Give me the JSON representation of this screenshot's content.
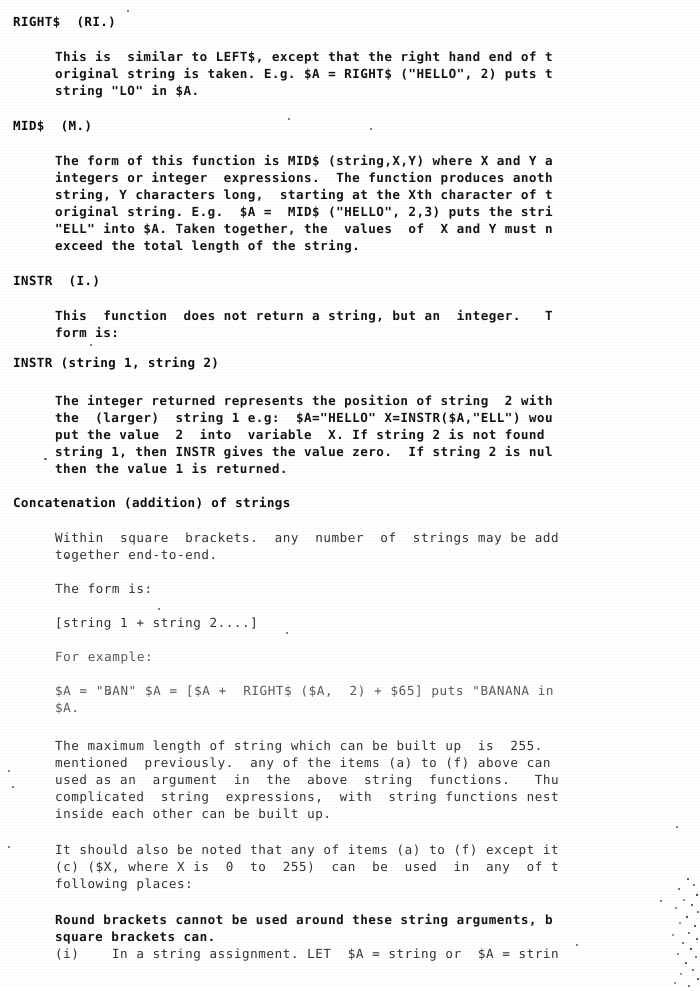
{
  "document": {
    "kind": "scanned-manual-page",
    "topic": "String functions — RIGHT$, MID$, INSTR, Concatenation",
    "background_color": "#ffffff",
    "ink_color": "#16161a",
    "right_edge_clipped": "true"
  },
  "sections": [
    {
      "heading": "RIGHT$  (RI.)",
      "lines": [
        "This is  similar to LEFT$, except that the right hand end of t",
        "original string is taken. E.g. $A = RIGHT$ (\"HELLO\", 2) puts t",
        "string \"LO\" in $A."
      ]
    },
    {
      "heading": "MID$  (M.)",
      "lines": [
        "The form of this function is MID$ (string,X,Y) where X and Y a",
        "integers or integer  expressions.  The function produces anoth",
        "string, Y characters long,  starting at the Xth character of t",
        "original string. E.g.  $A =  MID$ (\"HELLO\", 2,3) puts the stri",
        "\"ELL\" into $A. Taken together, the  values  of  X and Y must n",
        "exceed the total length of the string."
      ]
    },
    {
      "heading": "INSTR  (I.)",
      "lines": [
        "This  function  does not return a string, but an  integer.   T",
        "form is:"
      ]
    }
  ],
  "instr_form": "INSTR (string 1, string 2)",
  "instr_body": [
    "The integer returned represents the position of string  2 with",
    "the  (larger)  string 1 e.g:  $A=\"HELLO\" X=INSTR($A,\"ELL\") wou",
    "put the value  2  into  variable  X. If string 2 is not found",
    "string 1, then INSTR gives the value zero.  If string 2 is nul",
    "then the value 1 is returned."
  ],
  "concat": {
    "heading": "Concatenation (addition) of strings",
    "intro": [
      "Within  square  brackets.  any  number  of  strings may be add",
      "together end-to-end."
    ],
    "form_label": "The form is:",
    "form": "[string 1 + string 2....]",
    "example_label": "For example:",
    "example": [
      "$A = \"BAN\" $A = [$A +  RIGHT$ ($A,  2) + $65] puts \"BANANA in",
      "$A."
    ],
    "max_length": [
      "The maximum length of string which can be built up  is  255.",
      "mentioned  previously.  any of the items (a) to (f) above can",
      "used as an  argument  in  the  above  string  functions.   Thu",
      "complicated  string  expressions,  with  string functions nest",
      "inside each other can be built up."
    ],
    "note": [
      "It should also be noted that any of items (a) to (f) except it",
      "(c) ($X, where X is  0  to  255)  can  be  used  in  any  of t",
      "following places:"
    ],
    "brackets": [
      "Round brackets cannot be used around these string arguments, b",
      "square brackets can."
    ],
    "item_i": "(i)    In a string assignment. LET  $A = string or  $A = strin"
  }
}
